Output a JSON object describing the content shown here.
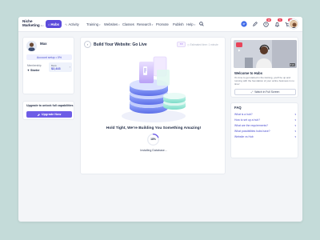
{
  "topnav": {
    "logo_line1": "Niche",
    "logo_line2": "Marketing",
    "logo_sup": "Inc",
    "hubs_label": "Hubs",
    "activity_label": "Activity",
    "menu": [
      {
        "label": "Training"
      },
      {
        "label": "Websites"
      },
      {
        "label": "Classes"
      },
      {
        "label": "Research"
      },
      {
        "label": "Promote"
      },
      {
        "label": "Publish"
      },
      {
        "label": "Help"
      }
    ],
    "badges": {
      "chat": "",
      "alerts": "12",
      "notifications": "5",
      "cart": "10"
    }
  },
  "profile": {
    "name": "Max",
    "setup_label": "Account setup • 0%",
    "membership_label": "Membership",
    "membership_value": "Starter",
    "balance_label": "Bank",
    "balance_value": "$2,443"
  },
  "upgrade": {
    "text": "Upgrade to unlock full capabilities",
    "button_label": "Upgrade Now"
  },
  "main": {
    "title": "Build Your Website: Go Live",
    "estimated": "Estimated time: 1 minute",
    "hold_text": "Hold Tight, We're Building You Something Amazing!",
    "progress_label": "18%",
    "progress_value": 0.18,
    "install_text": "Installing Database..."
  },
  "video": {
    "duration": "8:21",
    "title": "Welcome to Hubs",
    "desc": "It's time to get started in the training, you'll be up and running with the foundation of your online business in no time!",
    "button_label": "Watch in Full Screen"
  },
  "faq": {
    "title": "FAQ",
    "items": [
      {
        "q": "What is a hub?"
      },
      {
        "q": "How to set up a hub?"
      },
      {
        "q": "What are the requirements?"
      },
      {
        "q": "What possibilities hubs have?"
      },
      {
        "q": "Website vs Hub"
      }
    ]
  },
  "colors": {
    "background": "#c4dbd9",
    "accent": "#5b4bdb",
    "badge": "#e8445a"
  }
}
